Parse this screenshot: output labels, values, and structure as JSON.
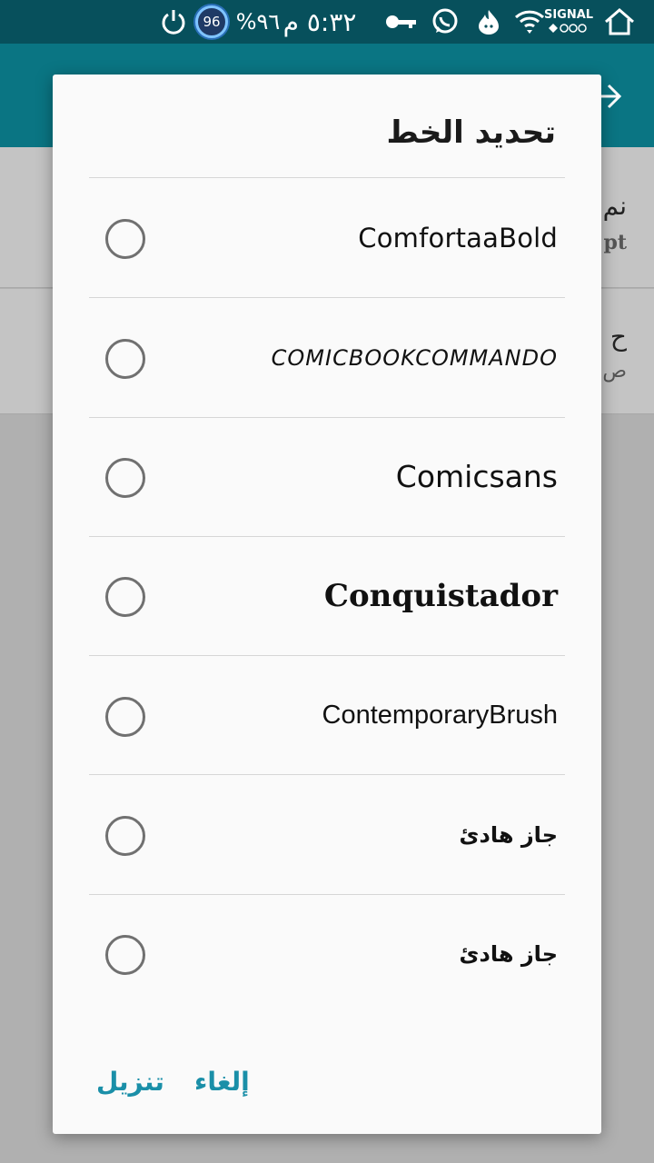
{
  "status_bar": {
    "time": "٥:٣٢ م",
    "battery": "%٩٦",
    "badge": "96",
    "signal_label": "SIGNAL"
  },
  "background": {
    "rows": [
      {
        "title": "نم",
        "subtitle": "pt"
      },
      {
        "title": "ح",
        "subtitle": "ص"
      }
    ]
  },
  "dialog": {
    "title": "تحديد الخط",
    "options": [
      {
        "label": "ComfortaaBold"
      },
      {
        "label": "COMICBOOKCOMMANDO"
      },
      {
        "label": "Comicsans"
      },
      {
        "label": "Conquistador"
      },
      {
        "label": "ContemporaryBrush"
      },
      {
        "label": "جاز هادئ"
      },
      {
        "label": "جاز هادئ"
      }
    ],
    "cancel_label": "إلغاء",
    "download_label": "تنزيل"
  },
  "colors": {
    "status_bar": "#07505c",
    "app_bar": "#0a7583",
    "accent": "#1a8fa8"
  }
}
